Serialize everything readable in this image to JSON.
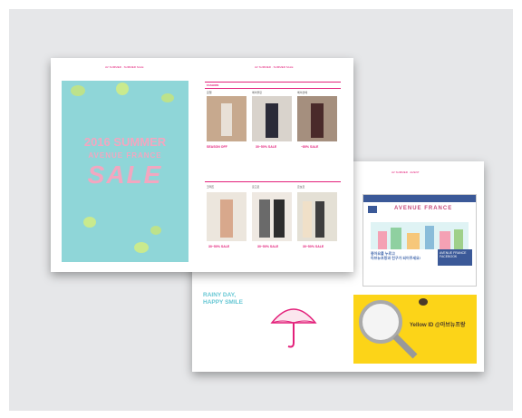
{
  "spread": {
    "header_left": "AV SUMMER · SUMMER SALE",
    "header_right": "AV SUMMER · SUMMER SALE",
    "cover_title": "2016 SUMMER",
    "cover_subtitle": "AVENUE FRANCE",
    "cover_sale": "SALE",
    "section_label": "FASHION",
    "brands": [
      "로엠",
      "에이블린",
      "에이션에",
      "코데즈",
      "로고로",
      "르보르"
    ],
    "promos": [
      "SEASON OFF",
      "30~50% SALE",
      "~80% SALE",
      "30~50% SALE",
      "30~50% SALE",
      "30~50% SALE"
    ]
  },
  "back_page": {
    "header": "AV SUMMER · EVENT",
    "logo": "AVENUE FRANCE",
    "fb_line1": "좋아요를 누르고",
    "fb_line2": "아브뉴프랑과 친구가 되어주세요!",
    "fb_box1": "AVENUE FRANCE",
    "fb_box2": "FACEBOOK",
    "rainy1": "RAINY DAY,",
    "rainy2": "HAPPY SMILE",
    "yellow_id": "Yellow ID @아브뉴프랑"
  }
}
